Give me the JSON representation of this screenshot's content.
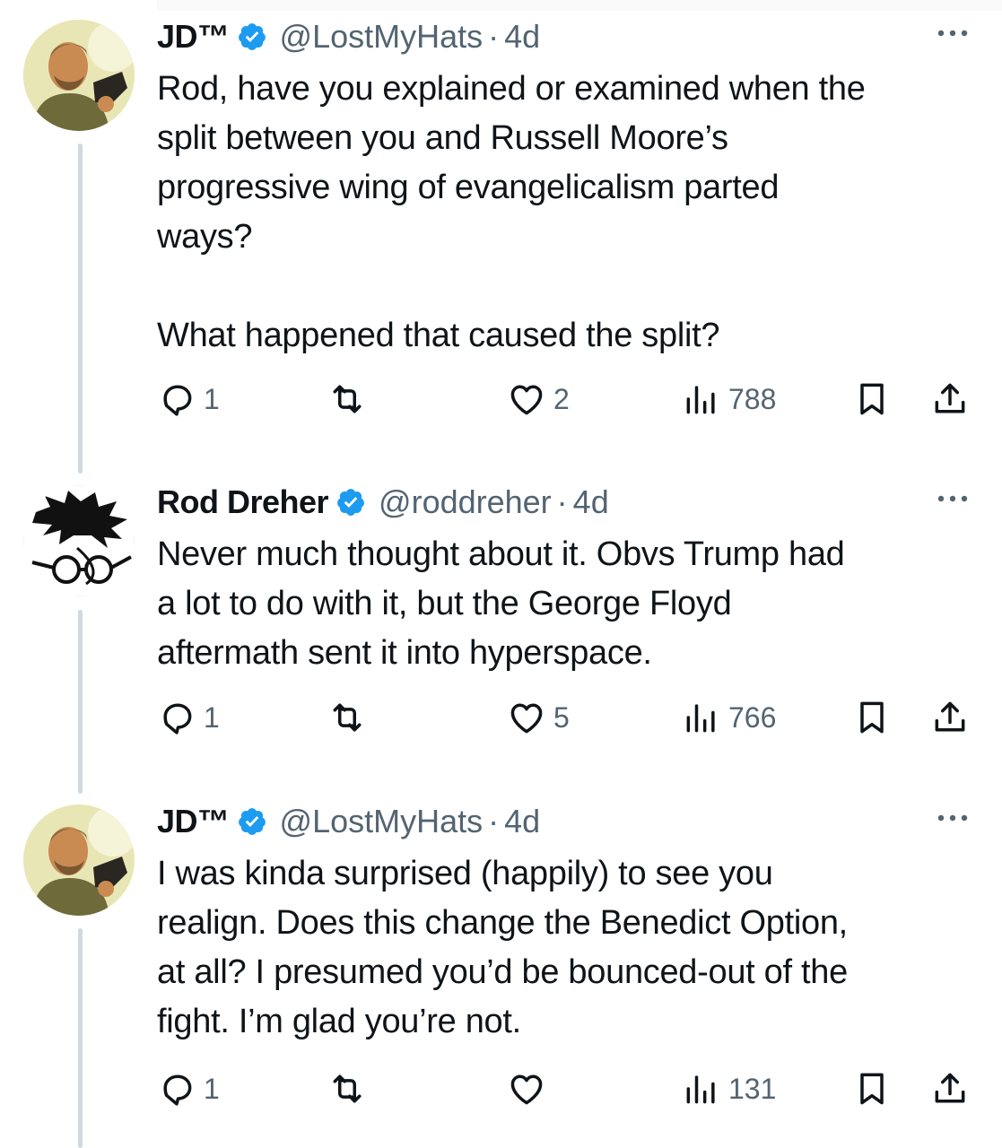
{
  "tweets": [
    {
      "name": "JD™",
      "handle": "@LostMyHats",
      "dot": "·",
      "time": "4d",
      "text": "Rod, have you explained or examined when the\nsplit between you and Russell Moore’s\nprogressive wing of evangelicalism parted\nways?\n\nWhat happened that caused the split?",
      "replies": "1",
      "reposts": "",
      "likes": "2",
      "views": "788"
    },
    {
      "name": "Rod Dreher",
      "handle": "@roddreher",
      "dot": "·",
      "time": "4d",
      "text": "Never much thought about it. Obvs Trump had\na lot to do with it, but the George Floyd\naftermath sent it into hyperspace.",
      "replies": "1",
      "reposts": "",
      "likes": "5",
      "views": "766"
    },
    {
      "name": "JD™",
      "handle": "@LostMyHats",
      "dot": "·",
      "time": "4d",
      "text": "I was kinda surprised (happily) to see you\nrealign. Does this change the Benedict Option,\nat all? I presumed you’d be bounced-out of the\nfight. I’m glad you’re not.",
      "replies": "1",
      "reposts": "",
      "likes": "",
      "views": "131"
    }
  ],
  "icons": {
    "verified": "verified-badge-icon",
    "more": "more-options-icon",
    "reply": "reply-icon",
    "repost": "repost-icon",
    "like": "like-icon",
    "views": "views-icon",
    "bookmark": "bookmark-icon",
    "share": "share-icon"
  },
  "colors": {
    "verified": "#1d9bf0",
    "muted": "#536471",
    "text": "#0f1419",
    "thread_line": "#cfd9de"
  }
}
